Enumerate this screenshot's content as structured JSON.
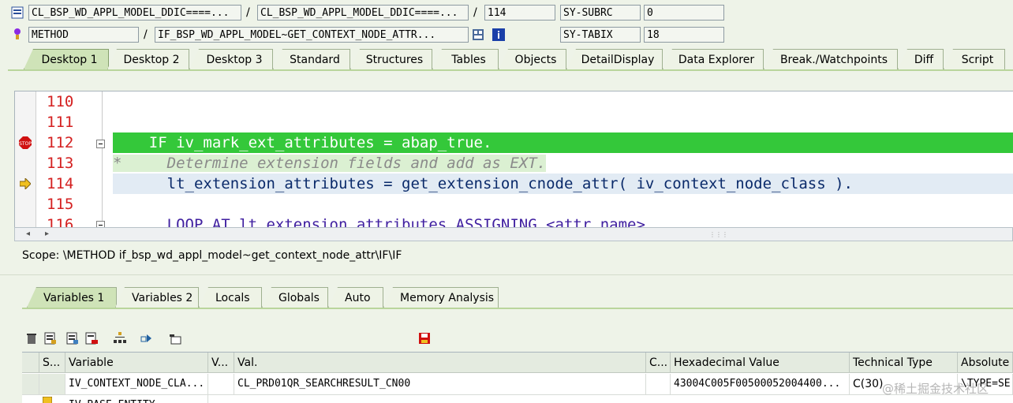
{
  "header": {
    "row1": {
      "program": "CL_BSP_WD_APPL_MODEL_DDIC====...",
      "include": "CL_BSP_WD_APPL_MODEL_DDIC====...",
      "line": "114",
      "sysvar_label": "SY-SUBRC",
      "sysvar_value": "0"
    },
    "row2": {
      "event_type": "METHOD",
      "event_name": "IF_BSP_WD_APPL_MODEL~GET_CONTEXT_NODE_ATTR...",
      "sysvar_label": "SY-TABIX",
      "sysvar_value": "18"
    }
  },
  "top_tabs": [
    "Desktop 1",
    "Desktop 2",
    "Desktop 3",
    "Standard",
    "Structures",
    "Tables",
    "Objects",
    "DetailDisplay",
    "Data Explorer",
    "Break./Watchpoints",
    "Diff",
    "Script"
  ],
  "editor": {
    "line_numbers": [
      "110",
      "111",
      "112",
      "113",
      "114",
      "115",
      "116"
    ],
    "lines": [
      "",
      "",
      "    IF iv_mark_ext_attributes = abap_true.",
      "*     Determine extension fields and add as EXT.",
      "      lt_extension_attributes = get_extension_cnode_attr( iv_context_node_class ).",
      "",
      "      LOOP AT lt_extension_attributes ASSIGNING <attr_name>."
    ]
  },
  "scope": "Scope: \\METHOD if_bsp_wd_appl_model~get_context_node_attr\\IF\\IF",
  "bottom_tabs": [
    "Variables 1",
    "Variables 2",
    "Locals",
    "Globals",
    "Auto",
    "Memory Analysis"
  ],
  "grid": {
    "headers": [
      "S...",
      "Variable",
      "V...",
      "Val.",
      "C...",
      "Hexadecimal Value",
      "Technical Type",
      "Absolute"
    ],
    "row1": [
      "IV_CONTEXT_NODE_CLA...",
      "CL_PRD01QR_SEARCHRESULT_CN00",
      "43004C005F00500052004400...",
      "C(30)",
      "\\TYPE=SE"
    ],
    "row2_variable": "IV_BASE_ENTITY"
  },
  "watermark": "@稀土掘金技术社区",
  "colors": {
    "breakpoint_line": "#34c83a",
    "current_line": "#e2ebf4",
    "line_number": "#d42020",
    "keyword": "#0000ff",
    "comment": "#8a8a8a",
    "tab_active": "#cfe3b8"
  }
}
